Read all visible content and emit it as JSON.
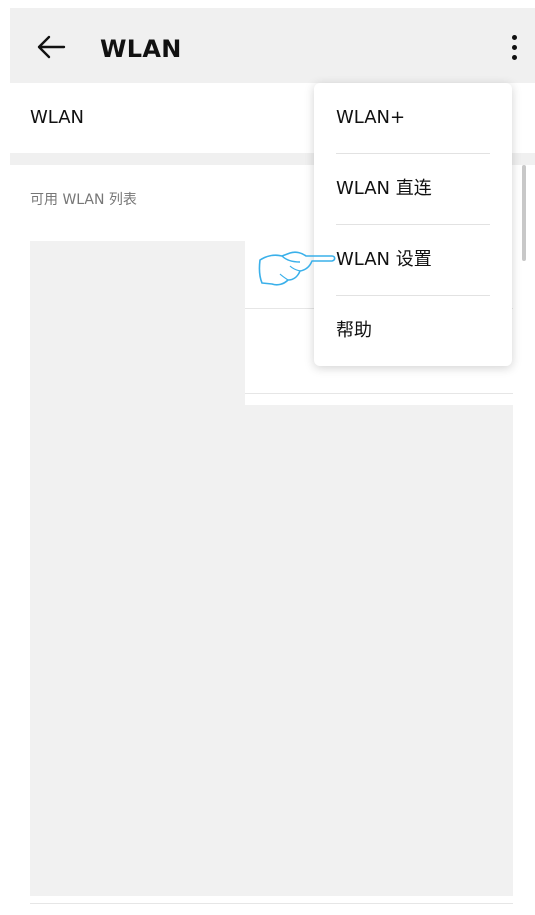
{
  "header": {
    "title": "WLAN",
    "back_icon": "arrow-left-icon",
    "more_icon": "more-vertical-icon"
  },
  "wlan_toggle_row": {
    "label": "WLAN"
  },
  "available_list": {
    "section_label": "可用 WLAN 列表"
  },
  "popup_menu": {
    "items": [
      {
        "label": "WLAN+"
      },
      {
        "label": "WLAN 直连"
      },
      {
        "label": "WLAN 设置"
      },
      {
        "label": "帮助"
      }
    ]
  },
  "annotation": {
    "icon": "pointing-hand-icon",
    "color": "#3ab0ea",
    "points_to": "WLAN 设置"
  }
}
